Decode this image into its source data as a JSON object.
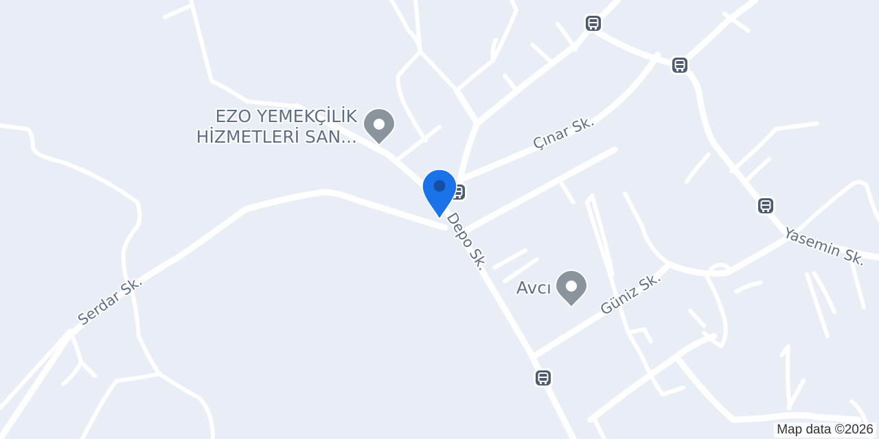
{
  "map": {
    "streets": {
      "cinar": "Çınar Sk.",
      "depo": "Depo Sk.",
      "serdar": "Serdar Sk.",
      "guniz": "Güniz Sk.",
      "yasemin": "Yasemin Sk."
    },
    "pois": {
      "ezo_line1": "EZO YEMEKÇİLİK",
      "ezo_line2": "HİZMETLERİ SAN...",
      "avci": "Avcı"
    },
    "attribution": "Map data ©2026",
    "icons": {
      "poi": "place-pin-icon",
      "bus": "bus-stop-icon",
      "location": "location-marker-icon"
    },
    "colors": {
      "background": "#e9edf6",
      "road": "#ffffff",
      "label": "#5f6e85",
      "poi_pin": "#8a949c",
      "bus_icon": "#4d5b6f",
      "location_marker": "#1a73e8"
    }
  }
}
